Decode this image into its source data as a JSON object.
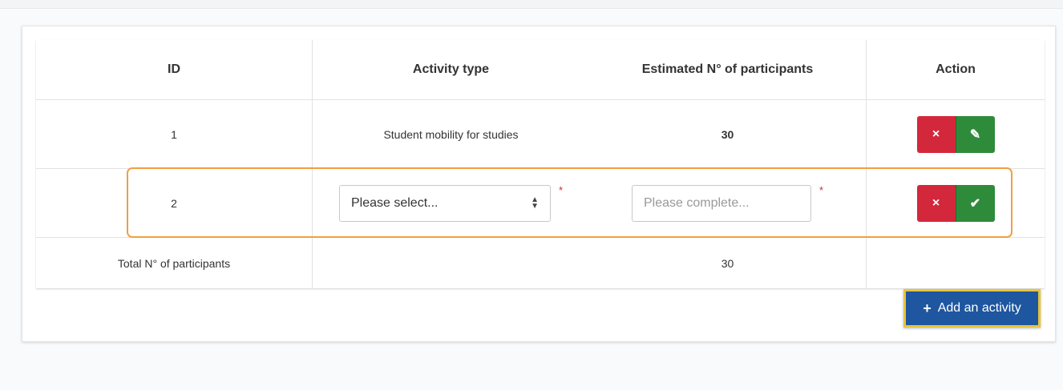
{
  "table": {
    "headers": {
      "id": "ID",
      "activity_type": "Activity type",
      "participants": "Estimated N° of participants",
      "action": "Action"
    },
    "rows": [
      {
        "id": "1",
        "activity_type": "Student mobility for studies",
        "participants": "30"
      },
      {
        "id": "2",
        "activity_select_value": "Please select...",
        "participants_placeholder": "Please complete..."
      }
    ],
    "total": {
      "label": "Total N° of participants",
      "value": "30"
    }
  },
  "required_marker": "*",
  "icons": {
    "delete": "×",
    "edit": "✎",
    "confirm": "✔",
    "select_up": "▲",
    "select_down": "▼",
    "plus": "+"
  },
  "add_button": {
    "label": "Add an activity"
  },
  "colors": {
    "delete": "#d3283b",
    "confirm": "#2e8b3a",
    "primary": "#1e56a0",
    "highlight": "#f0a040",
    "focus": "#e8c43a"
  }
}
